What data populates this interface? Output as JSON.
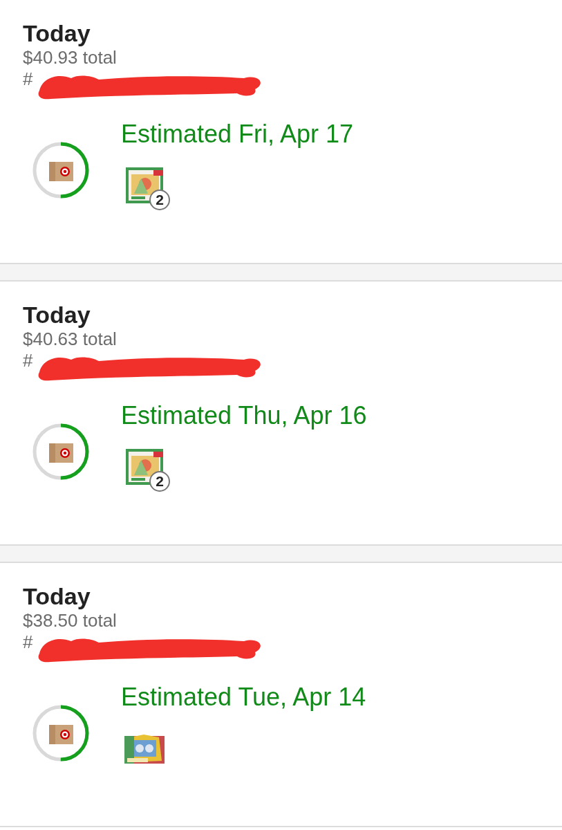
{
  "orders": [
    {
      "date_label": "Today",
      "total": "$40.93 total",
      "order_number": "#",
      "redacted": true,
      "progress": {
        "level": 0.5
      },
      "estimate": "Estimated Fri, Apr 17",
      "items": [
        {
          "kind": "picture",
          "quantity": "2"
        }
      ]
    },
    {
      "date_label": "Today",
      "total": "$40.63 total",
      "order_number": "#",
      "redacted": true,
      "progress": {
        "level": 0.5
      },
      "estimate": "Estimated Thu, Apr 16",
      "items": [
        {
          "kind": "picture",
          "quantity": "2"
        }
      ]
    },
    {
      "date_label": "Today",
      "total": "$38.50 total",
      "order_number": "#",
      "redacted": true,
      "progress": {
        "level": 0.5
      },
      "estimate": "Estimated Tue, Apr 14"
    }
  ]
}
